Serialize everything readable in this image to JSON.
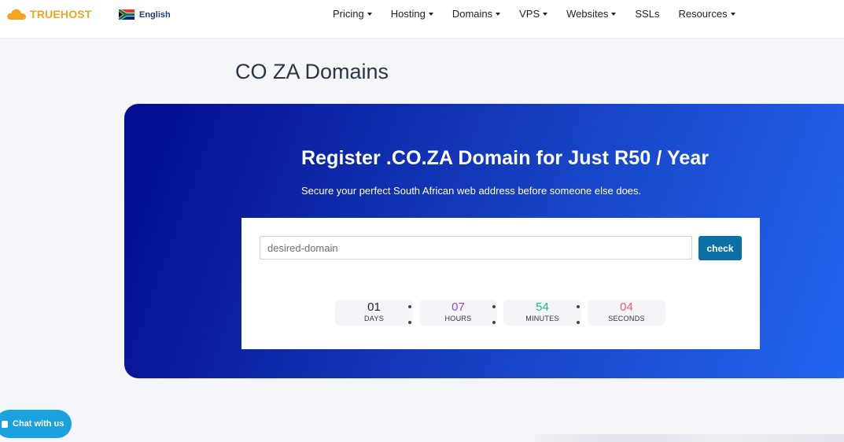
{
  "header": {
    "brand": "TRUEHOST",
    "language": "English",
    "nav": [
      {
        "label": "Pricing",
        "has_dropdown": true
      },
      {
        "label": "Hosting",
        "has_dropdown": true
      },
      {
        "label": "Domains",
        "has_dropdown": true
      },
      {
        "label": "VPS",
        "has_dropdown": true
      },
      {
        "label": "Websites",
        "has_dropdown": true
      },
      {
        "label": "SSLs",
        "has_dropdown": false
      },
      {
        "label": "Resources",
        "has_dropdown": true
      }
    ]
  },
  "page": {
    "title": "CO ZA Domains"
  },
  "hero": {
    "title": "Register .CO.ZA Domain for Just R50 / Year",
    "subtitle": "Secure your perfect South African web address before someone else does.",
    "search_placeholder": "desired-domain",
    "check_label": "check"
  },
  "countdown": [
    {
      "value": "01",
      "label": "DAYS",
      "color": "#222222"
    },
    {
      "value": "07",
      "label": "HOURS",
      "color": "#8b4cf0"
    },
    {
      "value": "54",
      "label": "MINUTES",
      "color": "#1fb87a"
    },
    {
      "value": "04",
      "label": "SECONDS",
      "color": "#ef5a6b"
    }
  ],
  "chat": {
    "label": "Chat with us"
  },
  "colors": {
    "brand": "#f7a51f",
    "hero_start": "#040b8e",
    "hero_end": "#2265f0",
    "button": "#0c6fa6",
    "chat": "#1aa2de"
  }
}
